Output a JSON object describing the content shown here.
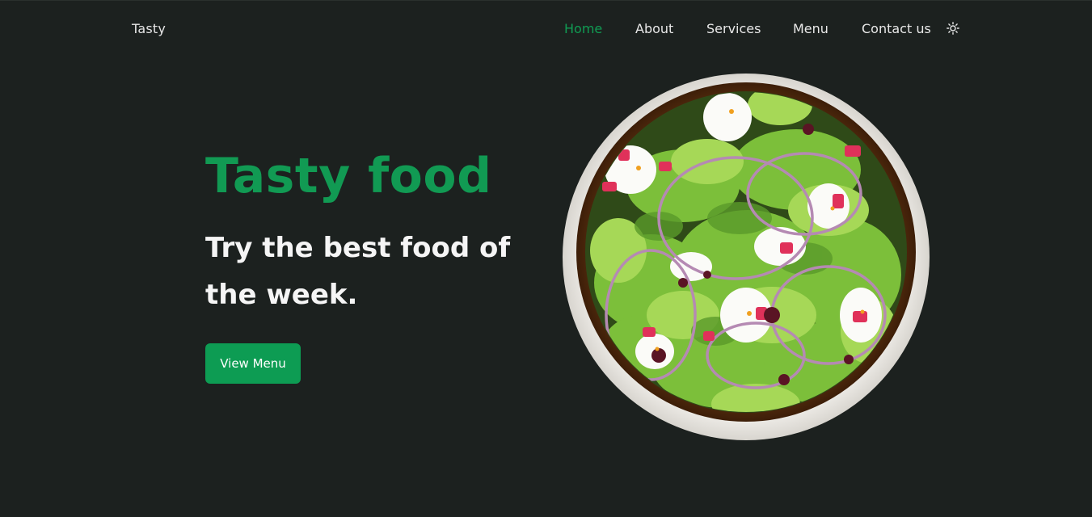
{
  "header": {
    "brand": "Tasty",
    "nav": {
      "home": "Home",
      "about": "About",
      "services": "Services",
      "menu": "Menu",
      "contact": "Contact us"
    },
    "active_nav": "Home",
    "theme_icon": "sun-icon"
  },
  "hero": {
    "title": "Tasty food",
    "subtitle": "Try the best food of the week.",
    "cta_label": "View Menu"
  },
  "colors": {
    "background": "#1c211f",
    "accent": "#119a53",
    "text": "#f5f5f5"
  }
}
